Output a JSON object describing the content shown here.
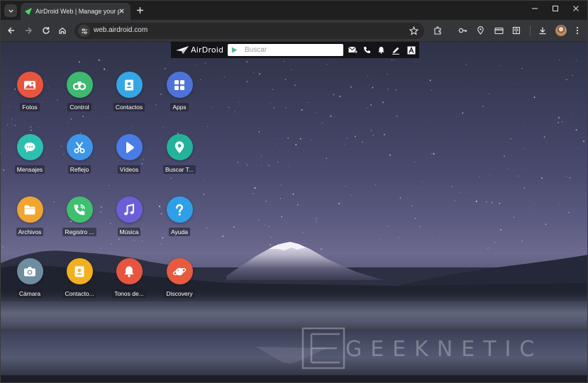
{
  "browser": {
    "tab_title": "AirDroid Web | Manage your phone",
    "url": "web.airdroid.com"
  },
  "airdroid": {
    "logo_text": "AirDroid",
    "search_placeholder": "Buscar"
  },
  "apps": [
    {
      "label": "Fotos",
      "icon": "photos-icon",
      "color": "#e8553f"
    },
    {
      "label": "Control",
      "icon": "binoculars-icon",
      "color": "#3fb872"
    },
    {
      "label": "Contactos",
      "icon": "contacts-icon",
      "color": "#35a7e6"
    },
    {
      "label": "Apps",
      "icon": "apps-grid-icon",
      "color": "#4f72d8"
    },
    {
      "label": "Mensajes",
      "icon": "chat-icon",
      "color": "#2cc0b0"
    },
    {
      "label": "Reflejo",
      "icon": "scissors-icon",
      "color": "#3d96e8"
    },
    {
      "label": "Vídeos",
      "icon": "play-icon",
      "color": "#4a7be6"
    },
    {
      "label": "Buscar T...",
      "icon": "location-pin-icon",
      "color": "#23b39a"
    },
    {
      "label": "Archivos",
      "icon": "folder-icon",
      "color": "#f0a431"
    },
    {
      "label": "Registro ...",
      "icon": "phone-call-icon",
      "color": "#3fbf70"
    },
    {
      "label": "Música",
      "icon": "music-note-icon",
      "color": "#6b5fd8"
    },
    {
      "label": "Ayuda",
      "icon": "help-icon",
      "color": "#2e9fe8"
    },
    {
      "label": "Cámara",
      "icon": "camera-icon",
      "color": "#6e8da0"
    },
    {
      "label": "Contacto...",
      "icon": "contact-card-icon",
      "color": "#f2b01e"
    },
    {
      "label": "Tonos de...",
      "icon": "bell-icon",
      "color": "#e8553f"
    },
    {
      "label": "Discovery",
      "icon": "planet-icon",
      "color": "#e85a3f"
    }
  ],
  "watermark": {
    "text": "GEEKNETIC",
    "letter": "E"
  }
}
